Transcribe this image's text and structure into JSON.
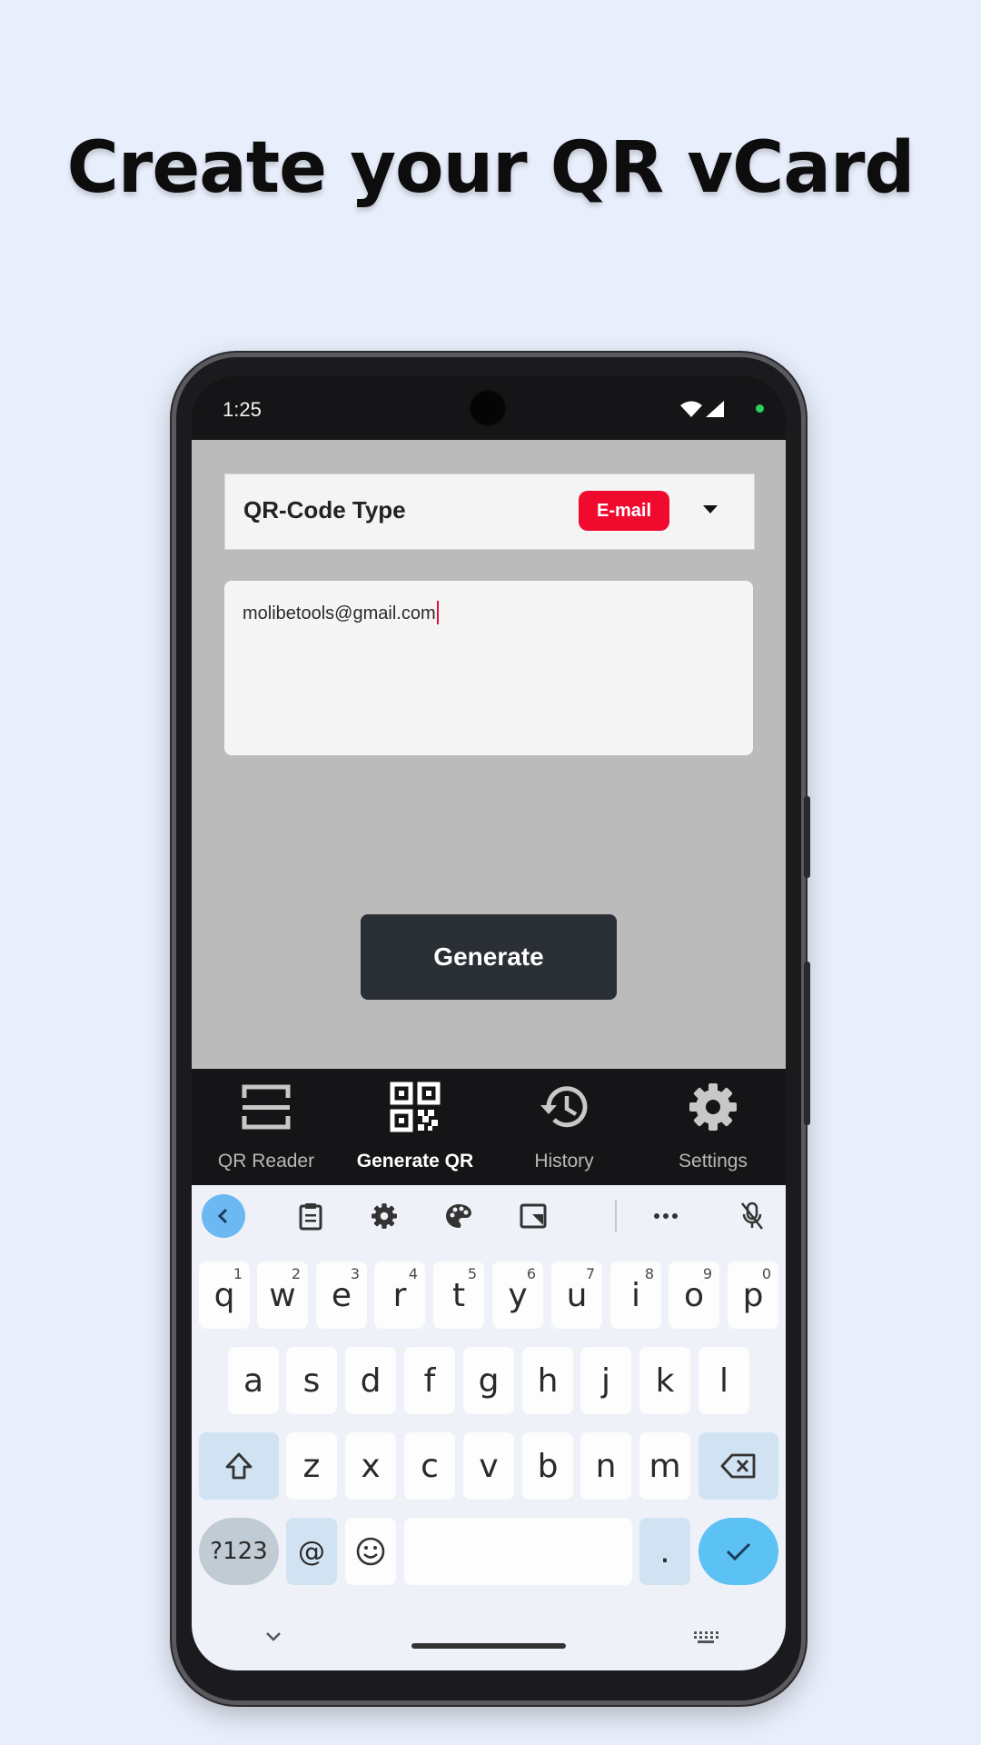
{
  "headline": "Create your QR vCard",
  "status_bar": {
    "time": "1:25"
  },
  "app": {
    "qr_type_label": "QR-Code Type",
    "qr_type_value": "E-mail",
    "input_value": "molibetools@gmail.com",
    "generate_label": "Generate"
  },
  "nav": {
    "items": [
      {
        "label": "QR Reader",
        "icon": "scan-frame-icon",
        "active": false
      },
      {
        "label": "Generate QR",
        "icon": "qr-code-icon",
        "active": true
      },
      {
        "label": "History",
        "icon": "history-icon",
        "active": false
      },
      {
        "label": "Settings",
        "icon": "gear-icon",
        "active": false
      }
    ]
  },
  "keyboard": {
    "row1": [
      {
        "k": "q",
        "n": "1"
      },
      {
        "k": "w",
        "n": "2"
      },
      {
        "k": "e",
        "n": "3"
      },
      {
        "k": "r",
        "n": "4"
      },
      {
        "k": "t",
        "n": "5"
      },
      {
        "k": "y",
        "n": "6"
      },
      {
        "k": "u",
        "n": "7"
      },
      {
        "k": "i",
        "n": "8"
      },
      {
        "k": "o",
        "n": "9"
      },
      {
        "k": "p",
        "n": "0"
      }
    ],
    "row2": [
      "a",
      "s",
      "d",
      "f",
      "g",
      "h",
      "j",
      "k",
      "l"
    ],
    "row3": [
      "z",
      "x",
      "c",
      "v",
      "b",
      "n",
      "m"
    ],
    "symbols_label": "?123",
    "at_label": "@",
    "period_label": "."
  },
  "colors": {
    "badge": "#ef0a2e",
    "accent_blue": "#5cc1f3",
    "nav_bg": "#151517",
    "page_bg": "#e8eefb"
  }
}
